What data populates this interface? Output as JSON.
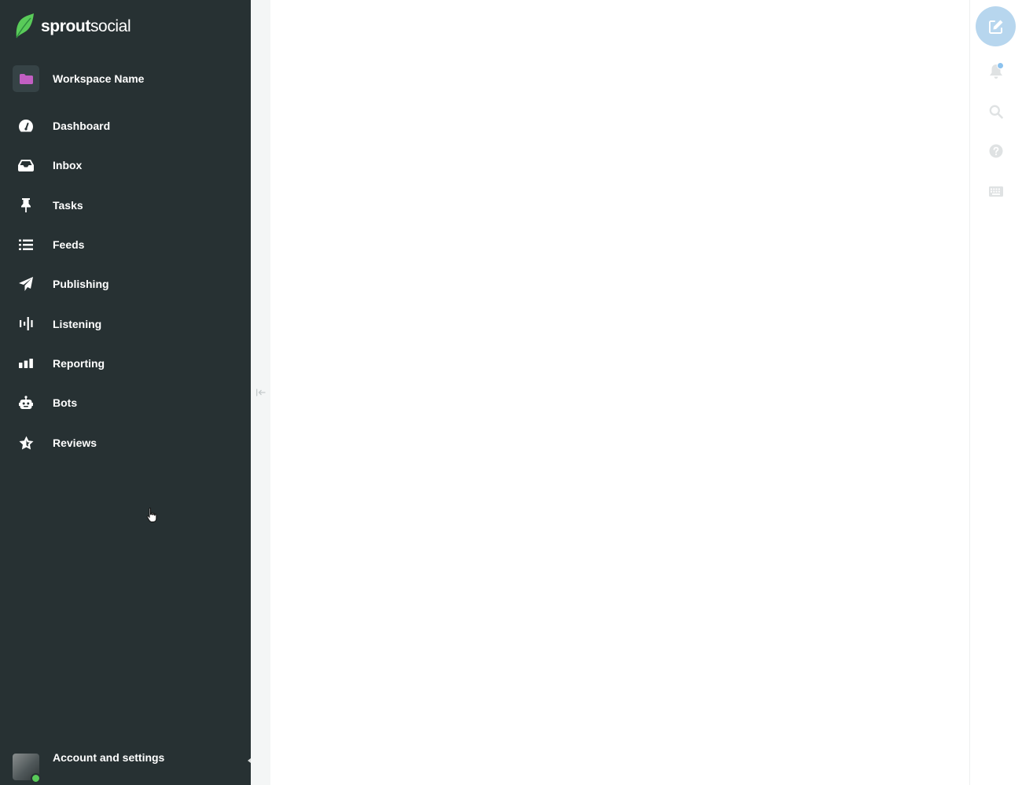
{
  "brand": {
    "name_bold": "sprout",
    "name_regular": "social",
    "logo_color": "#59cb59"
  },
  "theme": {
    "sidebar_bg": "#273133",
    "workspace_folder_color": "#c25fc3",
    "compose_bg": "#b7d6ee",
    "online_status_color": "#59cb59"
  },
  "workspace": {
    "label": "Workspace Name",
    "icon": "folder-icon"
  },
  "nav": {
    "items": [
      {
        "label": "Dashboard",
        "icon": "gauge-icon"
      },
      {
        "label": "Inbox",
        "icon": "inbox-icon"
      },
      {
        "label": "Tasks",
        "icon": "pin-icon"
      },
      {
        "label": "Feeds",
        "icon": "list-icon"
      },
      {
        "label": "Publishing",
        "icon": "paper-plane-icon"
      },
      {
        "label": "Listening",
        "icon": "sound-wave-icon"
      },
      {
        "label": "Reporting",
        "icon": "bar-chart-icon"
      },
      {
        "label": "Bots",
        "icon": "robot-icon"
      },
      {
        "label": "Reviews",
        "icon": "star-icon"
      }
    ]
  },
  "account": {
    "label": "Account and settings",
    "status": "online"
  },
  "rail": {
    "icons": [
      "compose-icon",
      "bell-icon",
      "search-icon",
      "help-icon",
      "keyboard-icon"
    ]
  }
}
